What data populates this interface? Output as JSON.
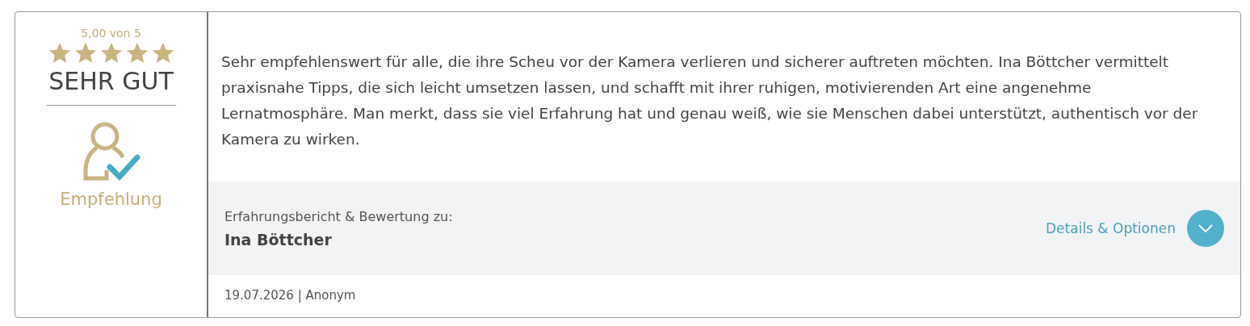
{
  "rating": {
    "score": "5,00 von 5",
    "stars": 5,
    "verdict": "SEHR GUT",
    "recommendation": "Empfehlung"
  },
  "review": {
    "text": "Sehr empfehlenswert für alle, die ihre Scheu vor der Kamera verlieren und sicherer auftreten möchten. Ina Böttcher vermittelt praxisnahe Tipps, die sich leicht umsetzen lassen, und schafft mit ihrer ruhigen, motivierenden Art eine angenehme Lernatmosphäre. Man merkt, dass sie viel Erfahrung hat und genau weiß, wie sie Menschen dabei unterstützt, authentisch vor der Kamera zu wirken.",
    "subject_label": "Erfahrungsbericht & Bewertung zu:",
    "subject": "Ina Böttcher",
    "details_link": "Details & Optionen",
    "meta": "19.07.2026 | Anonym"
  }
}
